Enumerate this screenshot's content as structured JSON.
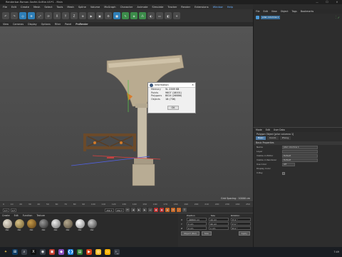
{
  "window": {
    "title": "Renderbar-Roman-Sezfel-Sciftie-V4l*1 - Main",
    "min": "—",
    "max": "☐",
    "close": "✕"
  },
  "menubar": [
    "File",
    "Edit",
    "Create",
    "Mesh",
    "Select",
    "Tools",
    "Mesh",
    "Spline",
    "Volume",
    "MoGraph",
    "Character",
    "Animate",
    "Simulate",
    "Tracker",
    "Render",
    "Extensions",
    "Window",
    "Help"
  ],
  "toolbar": {
    "x_label": "X",
    "y_label": "Y",
    "z_label": "Z"
  },
  "subbar": [
    "View",
    "Cameras",
    "Display",
    "Options",
    "Filter",
    "Panel",
    "ProRender"
  ],
  "viewport": {
    "hud": "Grid Spacing : 10000 cm"
  },
  "info_dialog": {
    "title": "Information",
    "rows": [
      {
        "label": "Memory",
        "value": "5L 2369 KB"
      },
      {
        "label": "Points",
        "value": "9607 (18001)"
      },
      {
        "label": "Polygons",
        "value": "8024 (26886)"
      },
      {
        "label": "Objects",
        "value": "18 (736)"
      }
    ],
    "ok": "OK"
  },
  "timeline": {
    "ticks": [
      "0",
      "10",
      "20",
      "30",
      "40",
      "50",
      "60",
      "70",
      "80",
      "90",
      "100",
      "110",
      "120",
      "130",
      "140",
      "150",
      "160",
      "170",
      "180",
      "190",
      "200",
      "210",
      "220",
      "230",
      "240",
      "250"
    ],
    "start": "0 F",
    "current": "0 F",
    "end": "250 F",
    "max": "250 F"
  },
  "materials": {
    "menu": [
      "Create",
      "Edit",
      "Function",
      "Texture"
    ],
    "items": [
      "Mat",
      "Mat",
      "Mat",
      "Mat",
      "Mat",
      "Mat",
      "Mat",
      "Mat"
    ]
  },
  "coordinates": {
    "headers": [
      "Position",
      "Size",
      "Rotation"
    ],
    "rows": [
      {
        "axis": "X",
        "pos": "-46800 cm",
        "size": "44 cm",
        "rot": "H  0 °"
      },
      {
        "axis": "Y",
        "pos": "0 cm",
        "size": "90 cm",
        "rot": "P  0 °"
      },
      {
        "axis": "Z",
        "pos": "0 cm",
        "size": "1 cm",
        "rot": "B  0 °"
      }
    ],
    "mode": "Object (Rel)",
    "size_mode": "Size",
    "apply": "Apply"
  },
  "object_manager": {
    "menu": [
      "File",
      "Edit",
      "View",
      "Object",
      "Tags",
      "Bookmarks"
    ],
    "item": "pilar columna 1"
  },
  "attributes": {
    "menu": [
      "Mode",
      "Edit",
      "User Data"
    ],
    "title": "Polygon Object [pilar columna 1]",
    "tabs": [
      "Basic",
      "Coord.",
      "Phong"
    ],
    "section": "Basic Properties",
    "props": [
      {
        "label": "Name",
        "value": "pilar columna 1"
      },
      {
        "label": "Layer",
        "value": ""
      },
      {
        "label": "Visible in Editor",
        "value": "Default"
      },
      {
        "label": "Visible in Renderer",
        "value": "Default"
      },
      {
        "label": "Use Color",
        "value": "Off"
      },
      {
        "label": "Display Color",
        "value": ""
      },
      {
        "label": "X-Ray",
        "value": ""
      }
    ]
  },
  "taskbar": {
    "clock": "7:49"
  }
}
